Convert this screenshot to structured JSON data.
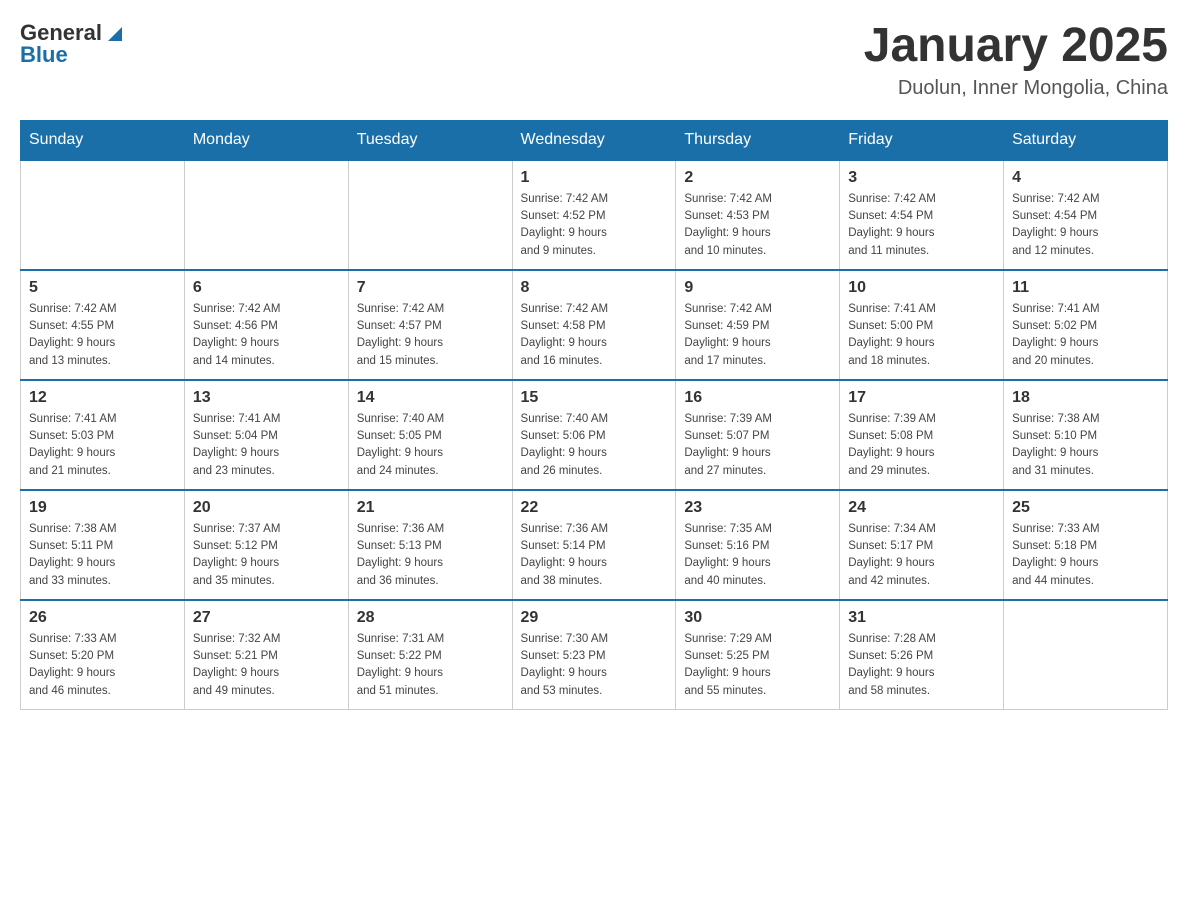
{
  "header": {
    "logo_general": "General",
    "logo_blue": "Blue",
    "title": "January 2025",
    "subtitle": "Duolun, Inner Mongolia, China"
  },
  "days_of_week": [
    "Sunday",
    "Monday",
    "Tuesday",
    "Wednesday",
    "Thursday",
    "Friday",
    "Saturday"
  ],
  "weeks": [
    [
      {
        "day": "",
        "info": ""
      },
      {
        "day": "",
        "info": ""
      },
      {
        "day": "",
        "info": ""
      },
      {
        "day": "1",
        "info": "Sunrise: 7:42 AM\nSunset: 4:52 PM\nDaylight: 9 hours\nand 9 minutes."
      },
      {
        "day": "2",
        "info": "Sunrise: 7:42 AM\nSunset: 4:53 PM\nDaylight: 9 hours\nand 10 minutes."
      },
      {
        "day": "3",
        "info": "Sunrise: 7:42 AM\nSunset: 4:54 PM\nDaylight: 9 hours\nand 11 minutes."
      },
      {
        "day": "4",
        "info": "Sunrise: 7:42 AM\nSunset: 4:54 PM\nDaylight: 9 hours\nand 12 minutes."
      }
    ],
    [
      {
        "day": "5",
        "info": "Sunrise: 7:42 AM\nSunset: 4:55 PM\nDaylight: 9 hours\nand 13 minutes."
      },
      {
        "day": "6",
        "info": "Sunrise: 7:42 AM\nSunset: 4:56 PM\nDaylight: 9 hours\nand 14 minutes."
      },
      {
        "day": "7",
        "info": "Sunrise: 7:42 AM\nSunset: 4:57 PM\nDaylight: 9 hours\nand 15 minutes."
      },
      {
        "day": "8",
        "info": "Sunrise: 7:42 AM\nSunset: 4:58 PM\nDaylight: 9 hours\nand 16 minutes."
      },
      {
        "day": "9",
        "info": "Sunrise: 7:42 AM\nSunset: 4:59 PM\nDaylight: 9 hours\nand 17 minutes."
      },
      {
        "day": "10",
        "info": "Sunrise: 7:41 AM\nSunset: 5:00 PM\nDaylight: 9 hours\nand 18 minutes."
      },
      {
        "day": "11",
        "info": "Sunrise: 7:41 AM\nSunset: 5:02 PM\nDaylight: 9 hours\nand 20 minutes."
      }
    ],
    [
      {
        "day": "12",
        "info": "Sunrise: 7:41 AM\nSunset: 5:03 PM\nDaylight: 9 hours\nand 21 minutes."
      },
      {
        "day": "13",
        "info": "Sunrise: 7:41 AM\nSunset: 5:04 PM\nDaylight: 9 hours\nand 23 minutes."
      },
      {
        "day": "14",
        "info": "Sunrise: 7:40 AM\nSunset: 5:05 PM\nDaylight: 9 hours\nand 24 minutes."
      },
      {
        "day": "15",
        "info": "Sunrise: 7:40 AM\nSunset: 5:06 PM\nDaylight: 9 hours\nand 26 minutes."
      },
      {
        "day": "16",
        "info": "Sunrise: 7:39 AM\nSunset: 5:07 PM\nDaylight: 9 hours\nand 27 minutes."
      },
      {
        "day": "17",
        "info": "Sunrise: 7:39 AM\nSunset: 5:08 PM\nDaylight: 9 hours\nand 29 minutes."
      },
      {
        "day": "18",
        "info": "Sunrise: 7:38 AM\nSunset: 5:10 PM\nDaylight: 9 hours\nand 31 minutes."
      }
    ],
    [
      {
        "day": "19",
        "info": "Sunrise: 7:38 AM\nSunset: 5:11 PM\nDaylight: 9 hours\nand 33 minutes."
      },
      {
        "day": "20",
        "info": "Sunrise: 7:37 AM\nSunset: 5:12 PM\nDaylight: 9 hours\nand 35 minutes."
      },
      {
        "day": "21",
        "info": "Sunrise: 7:36 AM\nSunset: 5:13 PM\nDaylight: 9 hours\nand 36 minutes."
      },
      {
        "day": "22",
        "info": "Sunrise: 7:36 AM\nSunset: 5:14 PM\nDaylight: 9 hours\nand 38 minutes."
      },
      {
        "day": "23",
        "info": "Sunrise: 7:35 AM\nSunset: 5:16 PM\nDaylight: 9 hours\nand 40 minutes."
      },
      {
        "day": "24",
        "info": "Sunrise: 7:34 AM\nSunset: 5:17 PM\nDaylight: 9 hours\nand 42 minutes."
      },
      {
        "day": "25",
        "info": "Sunrise: 7:33 AM\nSunset: 5:18 PM\nDaylight: 9 hours\nand 44 minutes."
      }
    ],
    [
      {
        "day": "26",
        "info": "Sunrise: 7:33 AM\nSunset: 5:20 PM\nDaylight: 9 hours\nand 46 minutes."
      },
      {
        "day": "27",
        "info": "Sunrise: 7:32 AM\nSunset: 5:21 PM\nDaylight: 9 hours\nand 49 minutes."
      },
      {
        "day": "28",
        "info": "Sunrise: 7:31 AM\nSunset: 5:22 PM\nDaylight: 9 hours\nand 51 minutes."
      },
      {
        "day": "29",
        "info": "Sunrise: 7:30 AM\nSunset: 5:23 PM\nDaylight: 9 hours\nand 53 minutes."
      },
      {
        "day": "30",
        "info": "Sunrise: 7:29 AM\nSunset: 5:25 PM\nDaylight: 9 hours\nand 55 minutes."
      },
      {
        "day": "31",
        "info": "Sunrise: 7:28 AM\nSunset: 5:26 PM\nDaylight: 9 hours\nand 58 minutes."
      },
      {
        "day": "",
        "info": ""
      }
    ]
  ]
}
